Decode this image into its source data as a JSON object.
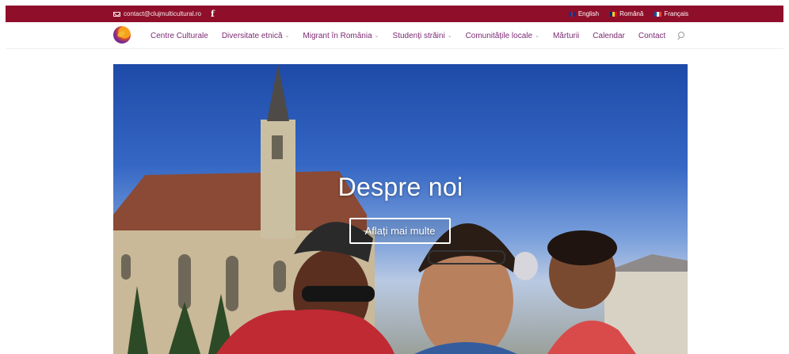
{
  "topbar": {
    "email": "contact@clujmulticultural.ro",
    "facebook_icon": "facebook-icon",
    "languages": [
      {
        "label": "English",
        "flag": "uk-flag-icon"
      },
      {
        "label": "Română",
        "flag": "romania-flag-icon"
      },
      {
        "label": "Français",
        "flag": "france-flag-icon"
      }
    ],
    "background_color": "#8f0f2a"
  },
  "nav": {
    "logo": "cluj-multicultural-logo",
    "items": [
      {
        "label": "Centre Culturale",
        "dropdown": false
      },
      {
        "label": "Diversitate etnică",
        "dropdown": true
      },
      {
        "label": "Migrant în România",
        "dropdown": true
      },
      {
        "label": "Studenți străini",
        "dropdown": true
      },
      {
        "label": "Comunitățile locale",
        "dropdown": true
      },
      {
        "label": "Mărturii",
        "dropdown": false
      },
      {
        "label": "Calendar",
        "dropdown": false
      },
      {
        "label": "Contact",
        "dropdown": false
      }
    ],
    "search_icon": "search-icon",
    "text_color": "#7c2a73"
  },
  "hero": {
    "title": "Despre noi",
    "button_label": "Aflați mai multe"
  }
}
